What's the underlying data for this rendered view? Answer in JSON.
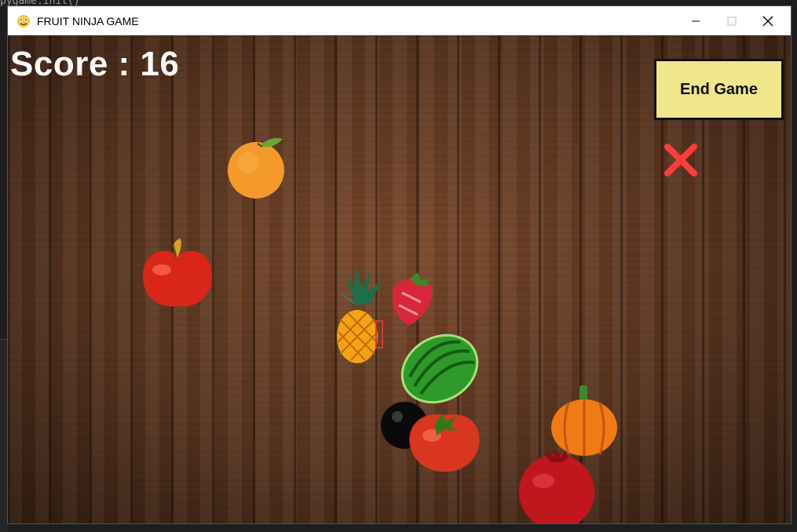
{
  "window": {
    "title": "FRUIT NINJA GAME"
  },
  "game": {
    "score_label": "Score : ",
    "score_value": "16",
    "end_button_label": "End Game",
    "lives_lost": 1,
    "objects": [
      {
        "kind": "orange-icon"
      },
      {
        "kind": "apple-icon"
      },
      {
        "kind": "pineapple-icon"
      },
      {
        "kind": "strawberry-icon"
      },
      {
        "kind": "watermelon-icon"
      },
      {
        "kind": "bomb-icon"
      },
      {
        "kind": "tomato-icon"
      },
      {
        "kind": "pumpkin-icon"
      },
      {
        "kind": "pomegranate-icon"
      }
    ]
  },
  "colors": {
    "button_bg": "#f0e68c",
    "strike": "#ff3b3b",
    "score_text": "#ffffff"
  }
}
